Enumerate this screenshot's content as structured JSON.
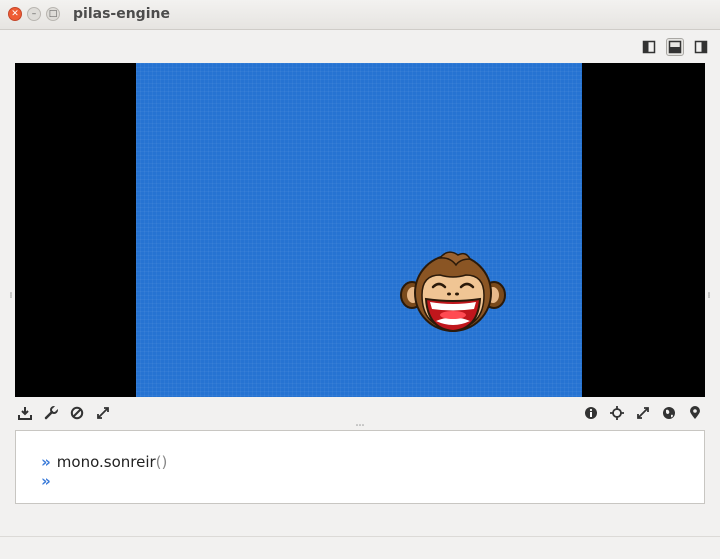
{
  "window": {
    "title": "pilas-engine",
    "buttons": [
      "close",
      "minimize",
      "maximize"
    ]
  },
  "layout_buttons": [
    {
      "name": "left-panel-layout-icon",
      "active": false
    },
    {
      "name": "bottom-panel-layout-icon",
      "active": true
    },
    {
      "name": "right-panel-layout-icon",
      "active": false
    }
  ],
  "stage": {
    "background_color": "#2673d2",
    "letterbox_color": "#000000",
    "actor": "monkey-laughing"
  },
  "toolbar_left": [
    "download-icon",
    "wrench-icon",
    "stop-icon",
    "fullscreen-icon"
  ],
  "toolbar_right": [
    "info-icon",
    "crosshair-icon",
    "expand-icon",
    "globe-icon",
    "location-pin-icon"
  ],
  "console": {
    "prompt": "»",
    "lines": [
      {
        "object": "mono",
        "method": ".sonreir",
        "args": "()"
      },
      {
        "object": "",
        "method": "",
        "args": ""
      }
    ]
  }
}
